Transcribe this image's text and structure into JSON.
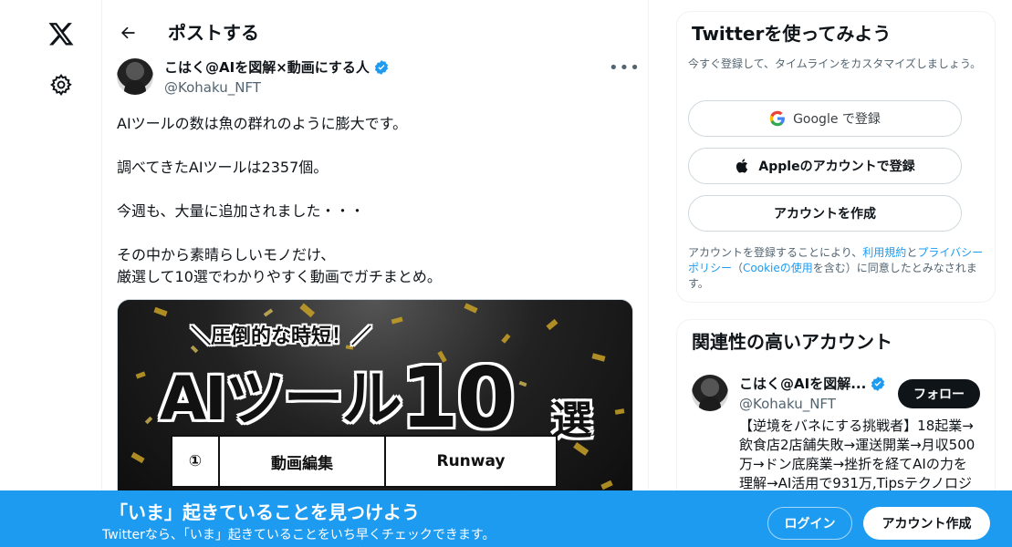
{
  "header": {
    "title": "ポストする"
  },
  "tweet": {
    "author_name": "こはく@AIを図解×動画にする人",
    "author_handle": "@Kohaku_NFT",
    "more_label": "•••",
    "lines": [
      "AIツールの数は魚の群れのように膨大です。",
      "調べてきたAIツールは2357個。",
      "今週も、大量に追加されました・・・",
      "その中から素晴らしいモノだけ、",
      "厳選して10選でわかりやすく動画でガチまとめ。"
    ],
    "media": {
      "tagline": "＼圧倒的な時短！／",
      "headline": "AIツール",
      "headline_number": "10",
      "headline_suffix": "選",
      "table": [
        {
          "no": "①",
          "category": "動画編集",
          "tool": "Runway"
        }
      ]
    }
  },
  "signup_card": {
    "title": "Twitterを使ってみよう",
    "subtitle": "今すぐ登録して、タイムラインをカスタマイズしましょう。",
    "google_label": "Google で登録",
    "apple_label": "Appleのアカウントで登録",
    "create_label": "アカウントを作成",
    "legal_prefix": "アカウントを登録することにより、",
    "terms_link": "利用規約",
    "legal_and": "と",
    "privacy_link": "プライバシーポリシー",
    "legal_open_paren": "（",
    "cookie_link": "Cookieの使用",
    "legal_suffix": "を含む）に同意したとみなされます。"
  },
  "related": {
    "title": "関連性の高いアカウント",
    "name": "こはく@AIを図解...",
    "handle": "@Kohaku_NFT",
    "follow_label": "フォロー",
    "bio": "【逆境をバネにする挑戦者】18起業→飲食店2店舗失敗→運送開業→月収500万→ドン底廃業→挫折を経てAIの力を理解→AI活用で931万,Tipsテクノロジ"
  },
  "banner": {
    "title": "「いま」起きていることを見つけよう",
    "subtitle": "Twitterなら、「いま」起きていることをいち早くチェックできます。",
    "login_label": "ログイン",
    "signup_label": "アカウント作成"
  },
  "colors": {
    "accent": "#1d9bf0",
    "text": "#0f1419",
    "muted": "#536471",
    "border": "#eff3f4"
  }
}
